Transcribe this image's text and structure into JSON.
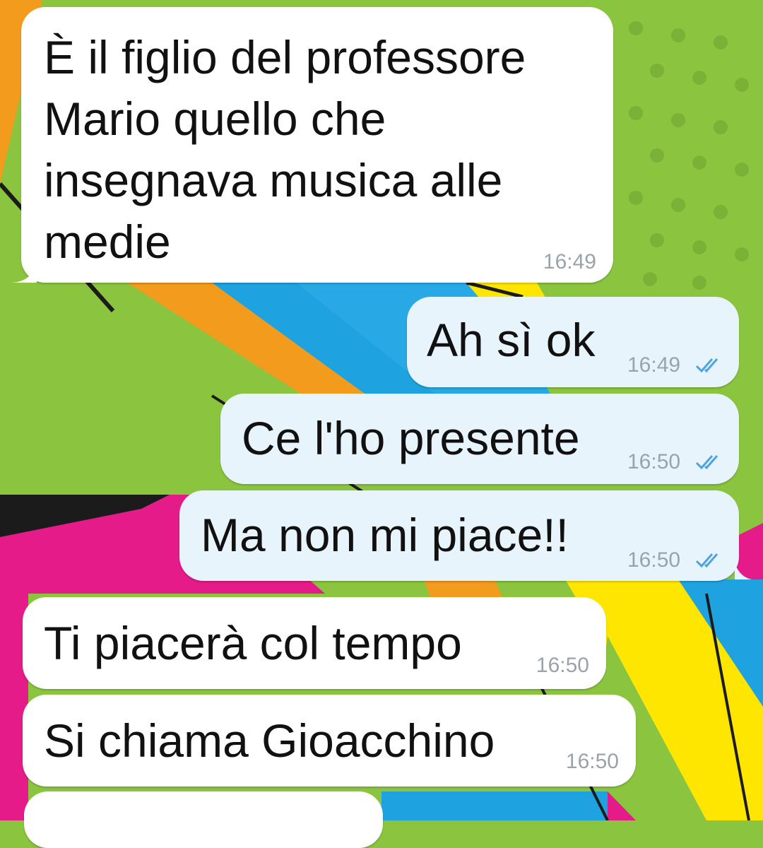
{
  "chat": {
    "messages": [
      {
        "direction": "incoming",
        "lines": [
          "È il figlio del professore",
          "Mario quello che",
          "insegnava musica alle",
          "medie"
        ],
        "time": "16:49"
      },
      {
        "direction": "outgoing",
        "text": "Ah sì ok",
        "time": "16:49",
        "status": "read"
      },
      {
        "direction": "outgoing",
        "text": "Ce l'ho presente",
        "time": "16:50",
        "status": "read"
      },
      {
        "direction": "outgoing",
        "text": "Ma non mi piace!!",
        "time": "16:50",
        "status": "read"
      },
      {
        "direction": "incoming",
        "text": "Ti piacerà col tempo",
        "time": "16:50"
      },
      {
        "direction": "incoming",
        "text": "Si chiama Gioacchino",
        "time": "16:50"
      }
    ]
  },
  "colors": {
    "incoming_bubble": "#ffffff",
    "outgoing_bubble": "#e8f4fc",
    "read_ticks": "#4fa3e0",
    "timestamp": "#9aa3aa"
  },
  "icons": {
    "read_receipt": "double-check-icon"
  }
}
